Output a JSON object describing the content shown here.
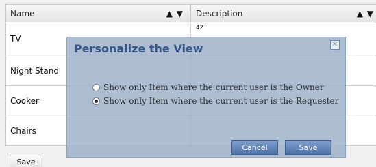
{
  "table": {
    "columns": [
      {
        "label": "Name",
        "sort": "▲ ▼"
      },
      {
        "label": "Description",
        "sort": "▲ ▼"
      }
    ],
    "rows": [
      {
        "name": "TV",
        "description": "42'"
      },
      {
        "name": "Night Stand",
        "description": ""
      },
      {
        "name": "Cooker",
        "description": ""
      },
      {
        "name": "Chairs",
        "description": ""
      }
    ]
  },
  "page": {
    "save_label": "Save"
  },
  "dialog": {
    "title": "Personalize the View",
    "close_icon": "close-icon",
    "options": [
      {
        "label": "Show only Item where the current user is the Owner",
        "selected": false
      },
      {
        "label": "Show only Item where the current user is the Requester",
        "selected": true
      }
    ],
    "cancel_label": "Cancel",
    "save_label": "Save"
  }
}
